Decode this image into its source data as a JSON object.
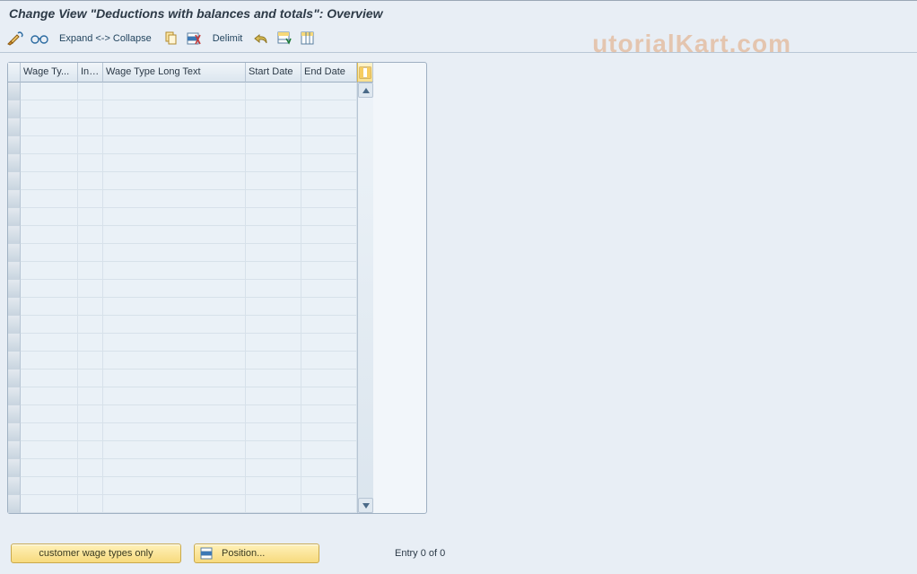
{
  "title": "Change View \"Deductions with balances and totals\": Overview",
  "toolbar": {
    "expand_collapse_label": "Expand <-> Collapse",
    "delimit_label": "Delimit"
  },
  "columns": {
    "wage_type": "Wage Ty...",
    "infotype": "Inf...",
    "wage_type_long": "Wage Type Long Text",
    "start_date": "Start Date",
    "end_date": "End Date"
  },
  "rows": [
    {
      "wage_type": "",
      "infotype": "",
      "wage_type_long": "",
      "start_date": "",
      "end_date": ""
    },
    {
      "wage_type": "",
      "infotype": "",
      "wage_type_long": "",
      "start_date": "",
      "end_date": ""
    },
    {
      "wage_type": "",
      "infotype": "",
      "wage_type_long": "",
      "start_date": "",
      "end_date": ""
    },
    {
      "wage_type": "",
      "infotype": "",
      "wage_type_long": "",
      "start_date": "",
      "end_date": ""
    },
    {
      "wage_type": "",
      "infotype": "",
      "wage_type_long": "",
      "start_date": "",
      "end_date": ""
    },
    {
      "wage_type": "",
      "infotype": "",
      "wage_type_long": "",
      "start_date": "",
      "end_date": ""
    },
    {
      "wage_type": "",
      "infotype": "",
      "wage_type_long": "",
      "start_date": "",
      "end_date": ""
    },
    {
      "wage_type": "",
      "infotype": "",
      "wage_type_long": "",
      "start_date": "",
      "end_date": ""
    },
    {
      "wage_type": "",
      "infotype": "",
      "wage_type_long": "",
      "start_date": "",
      "end_date": ""
    },
    {
      "wage_type": "",
      "infotype": "",
      "wage_type_long": "",
      "start_date": "",
      "end_date": ""
    },
    {
      "wage_type": "",
      "infotype": "",
      "wage_type_long": "",
      "start_date": "",
      "end_date": ""
    },
    {
      "wage_type": "",
      "infotype": "",
      "wage_type_long": "",
      "start_date": "",
      "end_date": ""
    },
    {
      "wage_type": "",
      "infotype": "",
      "wage_type_long": "",
      "start_date": "",
      "end_date": ""
    },
    {
      "wage_type": "",
      "infotype": "",
      "wage_type_long": "",
      "start_date": "",
      "end_date": ""
    },
    {
      "wage_type": "",
      "infotype": "",
      "wage_type_long": "",
      "start_date": "",
      "end_date": ""
    },
    {
      "wage_type": "",
      "infotype": "",
      "wage_type_long": "",
      "start_date": "",
      "end_date": ""
    },
    {
      "wage_type": "",
      "infotype": "",
      "wage_type_long": "",
      "start_date": "",
      "end_date": ""
    },
    {
      "wage_type": "",
      "infotype": "",
      "wage_type_long": "",
      "start_date": "",
      "end_date": ""
    },
    {
      "wage_type": "",
      "infotype": "",
      "wage_type_long": "",
      "start_date": "",
      "end_date": ""
    },
    {
      "wage_type": "",
      "infotype": "",
      "wage_type_long": "",
      "start_date": "",
      "end_date": ""
    },
    {
      "wage_type": "",
      "infotype": "",
      "wage_type_long": "",
      "start_date": "",
      "end_date": ""
    },
    {
      "wage_type": "",
      "infotype": "",
      "wage_type_long": "",
      "start_date": "",
      "end_date": ""
    },
    {
      "wage_type": "",
      "infotype": "",
      "wage_type_long": "",
      "start_date": "",
      "end_date": ""
    },
    {
      "wage_type": "",
      "infotype": "",
      "wage_type_long": "",
      "start_date": "",
      "end_date": ""
    }
  ],
  "footer": {
    "customer_wage_types_label": "customer wage types only",
    "position_label": "Position...",
    "entry_status": "Entry 0 of 0"
  },
  "watermark": "utorialKart.com"
}
